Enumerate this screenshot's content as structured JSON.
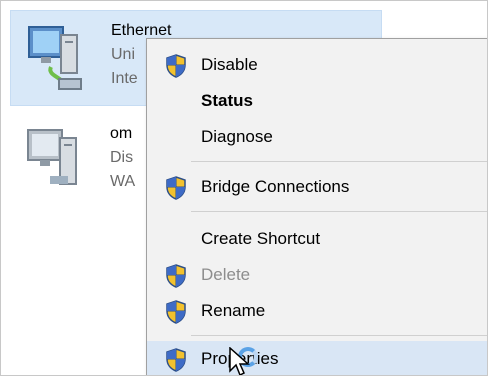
{
  "connections": [
    {
      "name": "Ethernet",
      "line2": "Uni",
      "line3": "Inte",
      "selected": true,
      "icon": "network-adapter-icon"
    },
    {
      "name": "om",
      "line2": "Dis",
      "line3": "WA",
      "selected": false,
      "icon": "network-adapter-icon"
    }
  ],
  "context_menu": {
    "items": [
      {
        "label": "Disable",
        "shield": true,
        "bold": false,
        "disabled": false
      },
      {
        "label": "Status",
        "shield": false,
        "bold": true,
        "disabled": false
      },
      {
        "label": "Diagnose",
        "shield": false,
        "bold": false,
        "disabled": false
      },
      {
        "label": "Bridge Connections",
        "shield": true,
        "bold": false,
        "disabled": false
      },
      {
        "label": "Create Shortcut",
        "shield": false,
        "bold": false,
        "disabled": false
      },
      {
        "label": "Delete",
        "shield": true,
        "bold": false,
        "disabled": true
      },
      {
        "label": "Rename",
        "shield": true,
        "bold": false,
        "disabled": false
      },
      {
        "label": "Properties",
        "shield": true,
        "bold": false,
        "disabled": false,
        "highlighted": true
      }
    ]
  },
  "colors": {
    "selection": "#d8e8f8",
    "menu_background": "#f2f2f2",
    "disabled_text": "#8d8d8d"
  }
}
